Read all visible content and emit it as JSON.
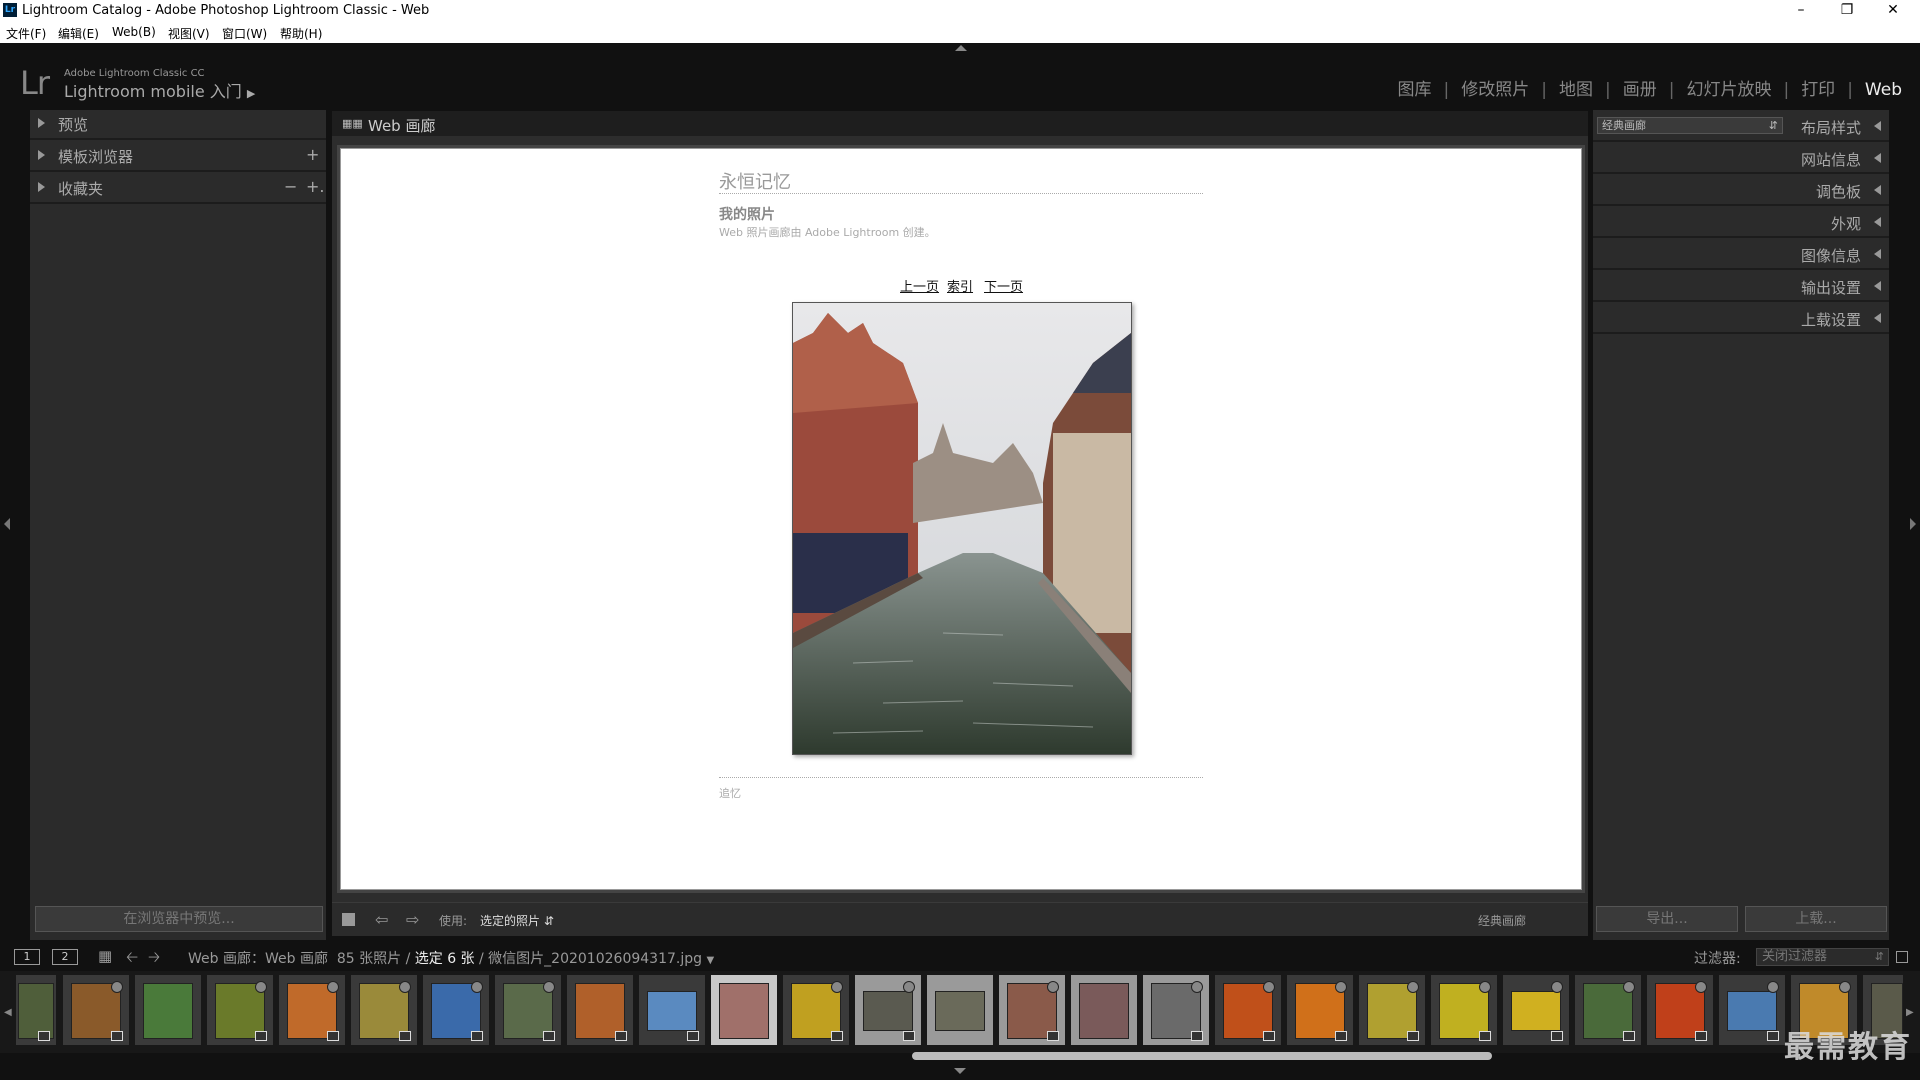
{
  "window": {
    "title": "Lightroom Catalog - Adobe Photoshop Lightroom Classic - Web",
    "app_icon": "Lr"
  },
  "menu": [
    "文件(F)",
    "编辑(E)",
    "Web(B)",
    "视图(V)",
    "窗口(W)",
    "帮助(H)"
  ],
  "identity": {
    "logo": "Lr",
    "product": "Adobe Lightroom Classic CC",
    "mobile": "Lightroom mobile 入门"
  },
  "modules": [
    "图库",
    "修改照片",
    "地图",
    "画册",
    "幻灯片放映",
    "打印",
    "Web"
  ],
  "active_module": "Web",
  "left_panel": {
    "sections": [
      "预览",
      "模板浏览器",
      "收藏夹"
    ],
    "template_add": "+",
    "collections_minus": "−",
    "collections_add": "+.",
    "preview_button": "在浏览器中预览..."
  },
  "center": {
    "header": "Web 画廊",
    "gallery": {
      "title": "永恒记忆",
      "subtitle": "我的照片",
      "description": "Web 照片画廊由 Adobe Lightroom 创建。",
      "nav": {
        "prev": "上一页",
        "index": "索引",
        "next": "下一页"
      },
      "footer": "追忆"
    }
  },
  "toolbar": {
    "use_label": "使用:",
    "use_value": "选定的照片",
    "style_name": "经典画廊"
  },
  "right_panel": {
    "layout_select": "经典画廊",
    "sections": [
      "布局样式",
      "网站信息",
      "调色板",
      "外观",
      "图像信息",
      "输出设置",
      "上载设置"
    ],
    "export_button": "导出...",
    "upload_button": "上载..."
  },
  "filmbar": {
    "monitor1": "1",
    "monitor2": "2",
    "source": "Web 画廊：Web 画廊",
    "count": "85 张照片 /",
    "selected": "选定 6 张",
    "filename": "/ 微信图片_20201026094317.jpg",
    "filter_label": "过滤器:",
    "filter_value": "关闭过滤器"
  },
  "watermark": "最需教育",
  "colors": {
    "accent": "#eeeeee",
    "panel": "#2b2b2b",
    "background": "#111111"
  }
}
